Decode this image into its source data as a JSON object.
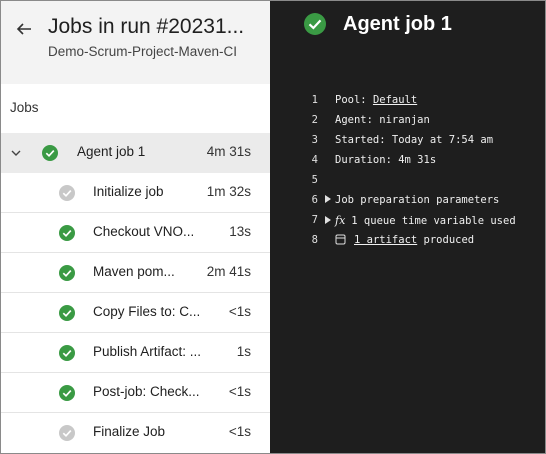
{
  "header": {
    "title": "Jobs in run #20231...",
    "subtitle": "Demo-Scrum-Project-Maven-CI"
  },
  "jobs_label": "Jobs",
  "jobs": [
    {
      "label": "Agent job 1",
      "duration": "4m 31s",
      "status": "succeeded",
      "expanded": true,
      "selected": true
    },
    {
      "label": "Initialize job",
      "duration": "1m 32s",
      "status": "skipped"
    },
    {
      "label": "Checkout VNO...",
      "duration": "13s",
      "status": "succeeded"
    },
    {
      "label": "Maven pom...",
      "duration": "2m 41s",
      "status": "succeeded"
    },
    {
      "label": "Copy Files to: C...",
      "duration": "<1s",
      "status": "succeeded"
    },
    {
      "label": "Publish Artifact: ...",
      "duration": "1s",
      "status": "succeeded"
    },
    {
      "label": "Post-job: Check...",
      "duration": "<1s",
      "status": "succeeded"
    },
    {
      "label": "Finalize Job",
      "duration": "<1s",
      "status": "skipped"
    }
  ],
  "job_detail": {
    "title": "Agent job 1",
    "lines": [
      {
        "n": "1",
        "prefix": "Pool: ",
        "link": "Default"
      },
      {
        "n": "2",
        "text": "Agent: niranjan"
      },
      {
        "n": "3",
        "text": "Started: Today at 7:54 am"
      },
      {
        "n": "4",
        "text": "Duration: 4m 31s"
      },
      {
        "n": "5",
        "text": ""
      },
      {
        "n": "6",
        "text": "Job preparation parameters"
      },
      {
        "n": "7",
        "text": "1 queue time variable used"
      },
      {
        "n": "8",
        "link": "1 artifact",
        "suffix": " produced"
      }
    ]
  },
  "colors": {
    "success": "#3a9a44",
    "skipped": "#c8c8c8",
    "panel_dark": "#1e1e1e",
    "header_bg": "#f3f3f3",
    "selected_row": "#ebebeb"
  },
  "icons": {
    "back": "arrow-left-icon",
    "expand": "chevron-down-icon",
    "success": "check-circle-icon",
    "skipped": "skipped-circle-icon",
    "expander": "triangle-right-icon",
    "variable": "fx-icon",
    "artifact": "artifact-icon"
  }
}
